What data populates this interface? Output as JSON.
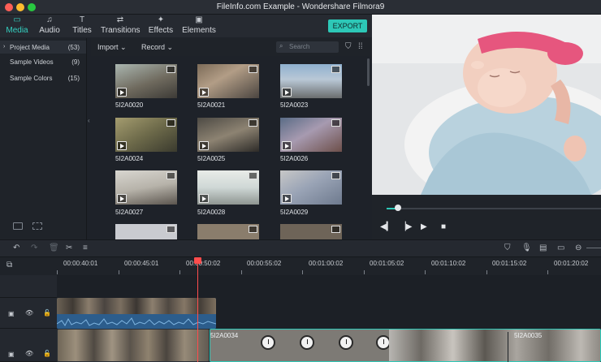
{
  "window": {
    "title": "FileInfo.com Example - Wondershare Filmora9"
  },
  "toolbar": {
    "tabs": [
      {
        "label": "Media",
        "icon": "folder-icon",
        "active": true
      },
      {
        "label": "Audio",
        "icon": "music-note-icon"
      },
      {
        "label": "Titles",
        "icon": "text-icon"
      },
      {
        "label": "Transitions",
        "icon": "transitions-icon"
      },
      {
        "label": "Effects",
        "icon": "effects-icon"
      },
      {
        "label": "Elements",
        "icon": "image-icon"
      }
    ],
    "export_label": "EXPORT"
  },
  "library": {
    "items": [
      {
        "name": "Project Media",
        "count": "(53)"
      },
      {
        "name": "Sample Videos",
        "count": "(9)"
      },
      {
        "name": "Sample Colors",
        "count": "(15)"
      }
    ]
  },
  "media": {
    "import_label": "Import",
    "record_label": "Record",
    "search_placeholder": "Search",
    "items": [
      {
        "name": "5I2A0020"
      },
      {
        "name": "5I2A0021"
      },
      {
        "name": "5I2A0023"
      },
      {
        "name": "5I2A0024"
      },
      {
        "name": "5I2A0025"
      },
      {
        "name": "5I2A0026"
      },
      {
        "name": "5I2A0027"
      },
      {
        "name": "5I2A0028"
      },
      {
        "name": "5I2A0029"
      }
    ]
  },
  "timeline": {
    "ruler": [
      "00:00:40:01",
      "00:00:45:01",
      "00:00:50:02",
      "00:00:55:02",
      "00:01:00:02",
      "00:01:05:02",
      "00:01:10:02",
      "00:01:15:02",
      "00:01:20:02"
    ],
    "clips": [
      {
        "name": "5I2A0034"
      },
      {
        "name": "5I2A0035"
      }
    ]
  },
  "colors": {
    "accent": "#2dc8b7",
    "playhead": "#ff4d4d"
  }
}
